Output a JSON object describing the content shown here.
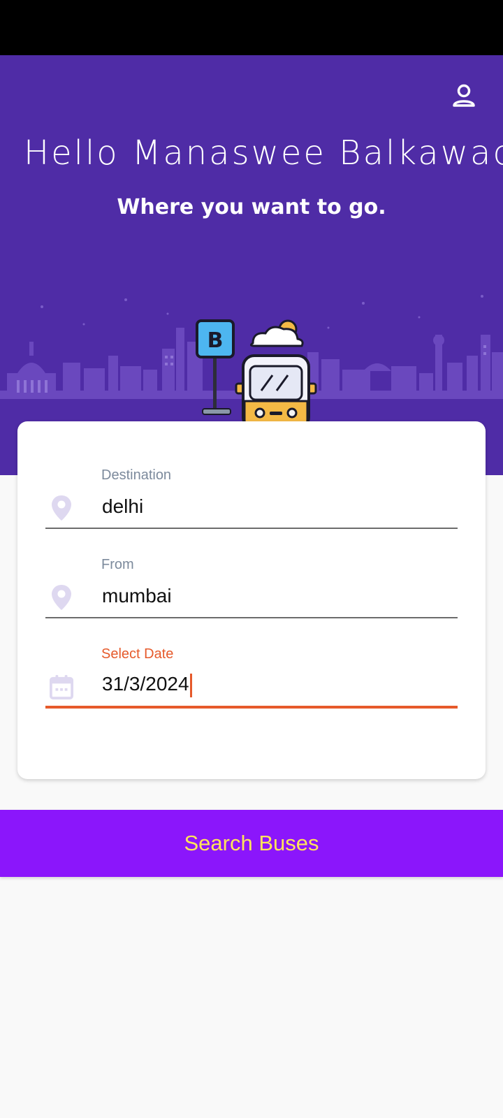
{
  "colors": {
    "status_bar": "#000000",
    "header_bg": "#4f2ca6",
    "accent_orange": "#e65a2b",
    "button_bg": "#8b16fb",
    "button_text": "#ffe45a",
    "icon_muted": "#ded8f0"
  },
  "header": {
    "greeting": "Hello Manaswee Balkawade",
    "subtitle": "Where you want to go.",
    "profile_icon": "person-icon",
    "bus_stop_sign": "B"
  },
  "form": {
    "destination": {
      "label": "Destination",
      "value": "delhi",
      "icon": "location-pin-icon"
    },
    "from": {
      "label": "From",
      "value": "mumbai",
      "icon": "location-pin-icon"
    },
    "date": {
      "label": "Select Date",
      "value": "31/3/2024",
      "icon": "calendar-icon"
    }
  },
  "search_button": {
    "label": "Search Buses"
  }
}
